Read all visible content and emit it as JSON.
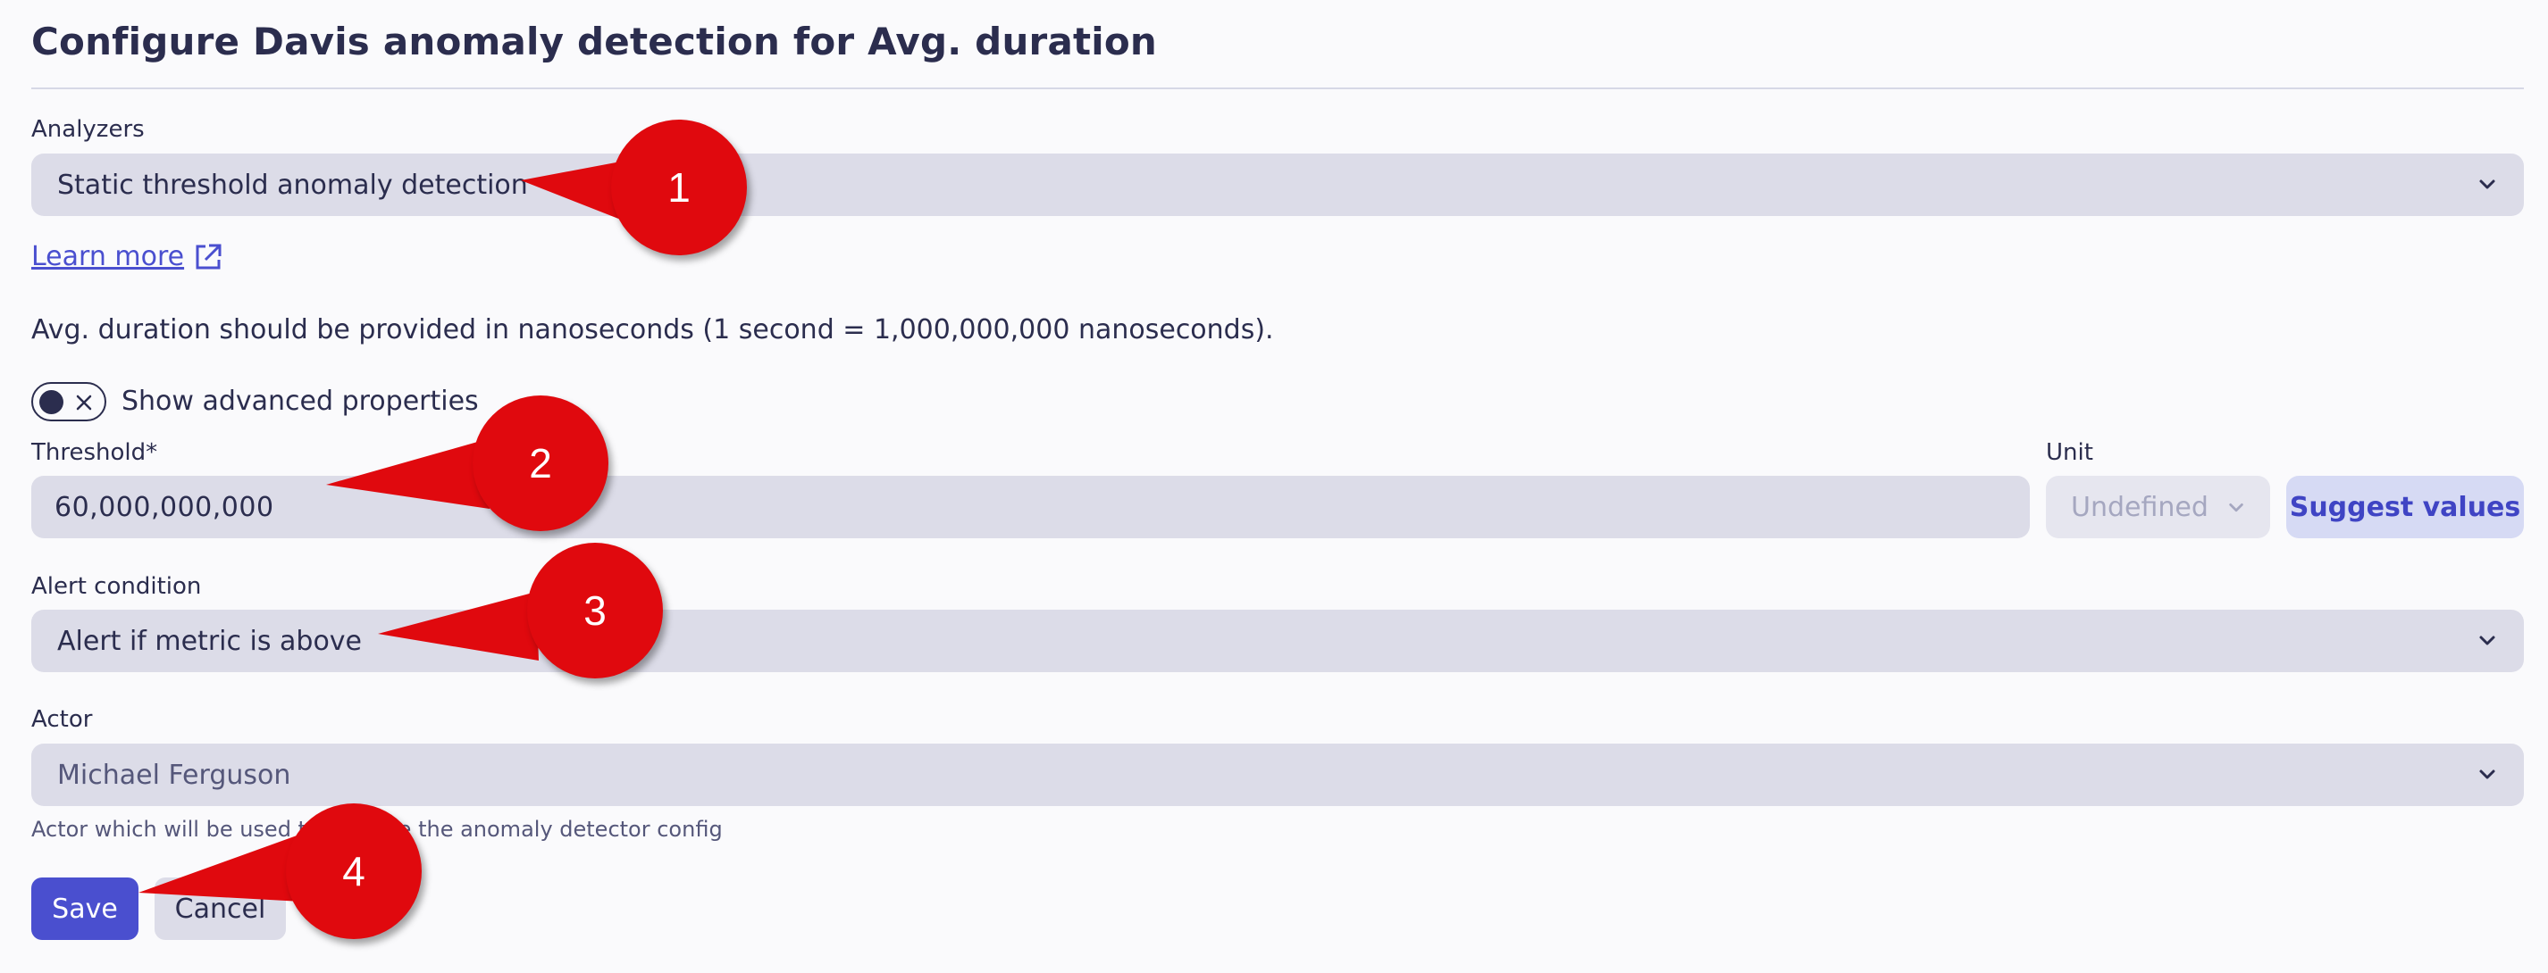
{
  "page": {
    "title": "Configure Davis anomaly detection for Avg. duration"
  },
  "analyzers": {
    "label": "Analyzers",
    "value": "Static threshold anomaly detection"
  },
  "learn_more": {
    "label": "Learn more",
    "icon": "external-link-icon"
  },
  "info_text": "Avg. duration should be provided in nanoseconds (1 second = 1,000,000,000 nanoseconds).",
  "advanced": {
    "label": "Show advanced properties",
    "enabled": false
  },
  "threshold": {
    "label": "Threshold*",
    "value": "60,000,000,000"
  },
  "unit": {
    "label": "Unit",
    "value": "Undefined"
  },
  "suggest_values": {
    "label": "Suggest values"
  },
  "alert_condition": {
    "label": "Alert condition",
    "value": "Alert if metric is above"
  },
  "actor": {
    "label": "Actor",
    "value": "Michael Ferguson",
    "helper": "Actor which will be used to execute the anomaly detector config"
  },
  "actions": {
    "save_label": "Save",
    "cancel_label": "Cancel"
  },
  "callouts": [
    "1",
    "2",
    "3",
    "4"
  ],
  "colors": {
    "primary": "#4a4fcf",
    "callout": "#e0090e",
    "field_bg": "#dcdce8",
    "text": "#2b2d4e"
  }
}
